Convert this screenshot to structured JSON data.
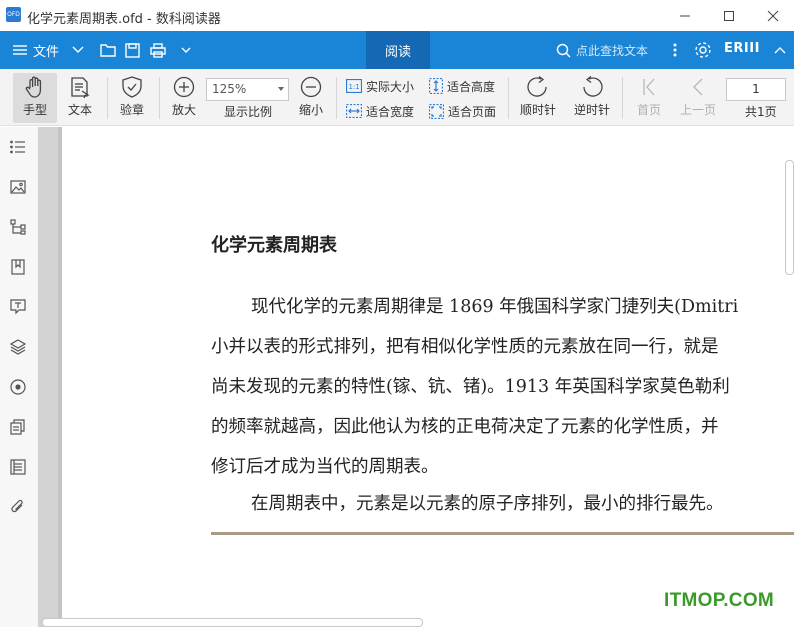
{
  "window": {
    "logo_text": "OFD",
    "title": "化学元素周期表.ofd - 数科阅读器"
  },
  "menubar": {
    "file_label": "文件",
    "read_tab": "阅读",
    "search_placeholder": "点此查找文本",
    "account_label": "ERIII"
  },
  "toolbar": {
    "hand_label": "手型",
    "text_label": "文本",
    "verify_label": "验章",
    "zoom_in_label": "放大",
    "zoom_value": "125%",
    "zoom_ratio_label": "显示比例",
    "zoom_out_label": "缩小",
    "actual_size_label": "实际大小",
    "fit_width_label": "适合宽度",
    "fit_height_label": "适合高度",
    "fit_page_label": "适合页面",
    "rotate_cw_label": "顺时针",
    "rotate_ccw_label": "逆时针",
    "first_page_label": "首页",
    "prev_page_label": "上一页",
    "page_number": "1",
    "total_pages": "共1页"
  },
  "document": {
    "title": "化学元素周期表",
    "lines": [
      "现代化学的元素周期律是 1869 年俄国科学家门捷列夫(Dmitri",
      "小并以表的形式排列，把有相似化学性质的元素放在同一行，就是",
      "尚未发现的元素的特性(镓、钪、锗)。1913 年英国科学家莫色勒利",
      "的频率就越高，因此他认为核的正电荷决定了元素的化学性质，并",
      "修订后才成为当代的周期表。",
      "在周期表中，元素是以元素的原子序排列，最小的排行最先。"
    ]
  },
  "watermark": "ITMOP.COM",
  "colors": {
    "menubar_blue": "#1a85d6",
    "read_tab_blue": "#1569b4",
    "watermark_green": "#3a9a2a"
  }
}
